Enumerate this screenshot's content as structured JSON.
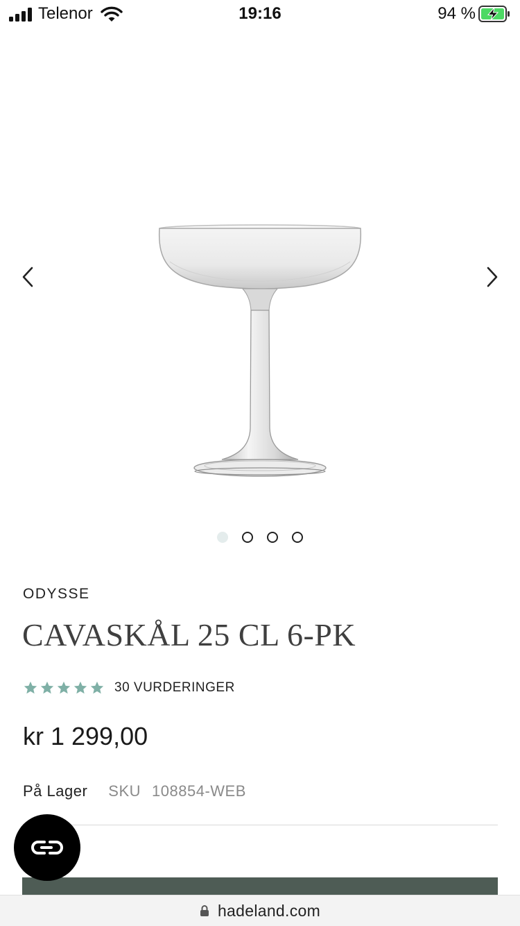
{
  "status_bar": {
    "carrier": "Telenor",
    "time": "19:16",
    "battery": "94 %",
    "icons": [
      "signal-icon",
      "wifi-icon",
      "battery-charging-icon"
    ]
  },
  "gallery": {
    "image_alt": "Cavaskål glass",
    "slide_count": 4,
    "active_slide": 1,
    "icons": [
      "chevron-left-icon",
      "chevron-right-icon"
    ]
  },
  "product": {
    "brand": "ODYSSE",
    "title": "CAVASKÅL 25 CL 6-PK",
    "rating": 5,
    "rating_max": 5,
    "reviews_label": "30 VURDERINGER",
    "price": "kr 1 299,00",
    "stock": "På Lager",
    "sku_label": "SKU",
    "sku": "108854-WEB"
  },
  "colors": {
    "star": "#7fb0a6",
    "cart_button": "#4e5c55",
    "chat_button": "#000000",
    "active_dot": "#e4ecec"
  },
  "browser": {
    "domain": "hadeland.com",
    "icon": "lock-icon"
  },
  "chat": {
    "icon": "chat-logo-icon"
  }
}
